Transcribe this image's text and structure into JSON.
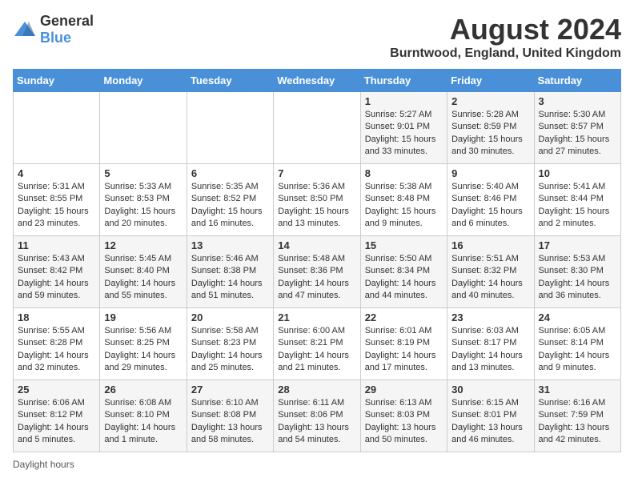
{
  "header": {
    "logo_general": "General",
    "logo_blue": "Blue",
    "month_title": "August 2024",
    "location": "Burntwood, England, United Kingdom"
  },
  "days_of_week": [
    "Sunday",
    "Monday",
    "Tuesday",
    "Wednesday",
    "Thursday",
    "Friday",
    "Saturday"
  ],
  "weeks": [
    [
      {
        "day": "",
        "info": ""
      },
      {
        "day": "",
        "info": ""
      },
      {
        "day": "",
        "info": ""
      },
      {
        "day": "",
        "info": ""
      },
      {
        "day": "1",
        "info": "Sunrise: 5:27 AM\nSunset: 9:01 PM\nDaylight: 15 hours\nand 33 minutes."
      },
      {
        "day": "2",
        "info": "Sunrise: 5:28 AM\nSunset: 8:59 PM\nDaylight: 15 hours\nand 30 minutes."
      },
      {
        "day": "3",
        "info": "Sunrise: 5:30 AM\nSunset: 8:57 PM\nDaylight: 15 hours\nand 27 minutes."
      }
    ],
    [
      {
        "day": "4",
        "info": "Sunrise: 5:31 AM\nSunset: 8:55 PM\nDaylight: 15 hours\nand 23 minutes."
      },
      {
        "day": "5",
        "info": "Sunrise: 5:33 AM\nSunset: 8:53 PM\nDaylight: 15 hours\nand 20 minutes."
      },
      {
        "day": "6",
        "info": "Sunrise: 5:35 AM\nSunset: 8:52 PM\nDaylight: 15 hours\nand 16 minutes."
      },
      {
        "day": "7",
        "info": "Sunrise: 5:36 AM\nSunset: 8:50 PM\nDaylight: 15 hours\nand 13 minutes."
      },
      {
        "day": "8",
        "info": "Sunrise: 5:38 AM\nSunset: 8:48 PM\nDaylight: 15 hours\nand 9 minutes."
      },
      {
        "day": "9",
        "info": "Sunrise: 5:40 AM\nSunset: 8:46 PM\nDaylight: 15 hours\nand 6 minutes."
      },
      {
        "day": "10",
        "info": "Sunrise: 5:41 AM\nSunset: 8:44 PM\nDaylight: 15 hours\nand 2 minutes."
      }
    ],
    [
      {
        "day": "11",
        "info": "Sunrise: 5:43 AM\nSunset: 8:42 PM\nDaylight: 14 hours\nand 59 minutes."
      },
      {
        "day": "12",
        "info": "Sunrise: 5:45 AM\nSunset: 8:40 PM\nDaylight: 14 hours\nand 55 minutes."
      },
      {
        "day": "13",
        "info": "Sunrise: 5:46 AM\nSunset: 8:38 PM\nDaylight: 14 hours\nand 51 minutes."
      },
      {
        "day": "14",
        "info": "Sunrise: 5:48 AM\nSunset: 8:36 PM\nDaylight: 14 hours\nand 47 minutes."
      },
      {
        "day": "15",
        "info": "Sunrise: 5:50 AM\nSunset: 8:34 PM\nDaylight: 14 hours\nand 44 minutes."
      },
      {
        "day": "16",
        "info": "Sunrise: 5:51 AM\nSunset: 8:32 PM\nDaylight: 14 hours\nand 40 minutes."
      },
      {
        "day": "17",
        "info": "Sunrise: 5:53 AM\nSunset: 8:30 PM\nDaylight: 14 hours\nand 36 minutes."
      }
    ],
    [
      {
        "day": "18",
        "info": "Sunrise: 5:55 AM\nSunset: 8:28 PM\nDaylight: 14 hours\nand 32 minutes."
      },
      {
        "day": "19",
        "info": "Sunrise: 5:56 AM\nSunset: 8:25 PM\nDaylight: 14 hours\nand 29 minutes."
      },
      {
        "day": "20",
        "info": "Sunrise: 5:58 AM\nSunset: 8:23 PM\nDaylight: 14 hours\nand 25 minutes."
      },
      {
        "day": "21",
        "info": "Sunrise: 6:00 AM\nSunset: 8:21 PM\nDaylight: 14 hours\nand 21 minutes."
      },
      {
        "day": "22",
        "info": "Sunrise: 6:01 AM\nSunset: 8:19 PM\nDaylight: 14 hours\nand 17 minutes."
      },
      {
        "day": "23",
        "info": "Sunrise: 6:03 AM\nSunset: 8:17 PM\nDaylight: 14 hours\nand 13 minutes."
      },
      {
        "day": "24",
        "info": "Sunrise: 6:05 AM\nSunset: 8:14 PM\nDaylight: 14 hours\nand 9 minutes."
      }
    ],
    [
      {
        "day": "25",
        "info": "Sunrise: 6:06 AM\nSunset: 8:12 PM\nDaylight: 14 hours\nand 5 minutes."
      },
      {
        "day": "26",
        "info": "Sunrise: 6:08 AM\nSunset: 8:10 PM\nDaylight: 14 hours\nand 1 minute."
      },
      {
        "day": "27",
        "info": "Sunrise: 6:10 AM\nSunset: 8:08 PM\nDaylight: 13 hours\nand 58 minutes."
      },
      {
        "day": "28",
        "info": "Sunrise: 6:11 AM\nSunset: 8:06 PM\nDaylight: 13 hours\nand 54 minutes."
      },
      {
        "day": "29",
        "info": "Sunrise: 6:13 AM\nSunset: 8:03 PM\nDaylight: 13 hours\nand 50 minutes."
      },
      {
        "day": "30",
        "info": "Sunrise: 6:15 AM\nSunset: 8:01 PM\nDaylight: 13 hours\nand 46 minutes."
      },
      {
        "day": "31",
        "info": "Sunrise: 6:16 AM\nSunset: 7:59 PM\nDaylight: 13 hours\nand 42 minutes."
      }
    ]
  ],
  "footer": {
    "note": "Daylight hours"
  }
}
